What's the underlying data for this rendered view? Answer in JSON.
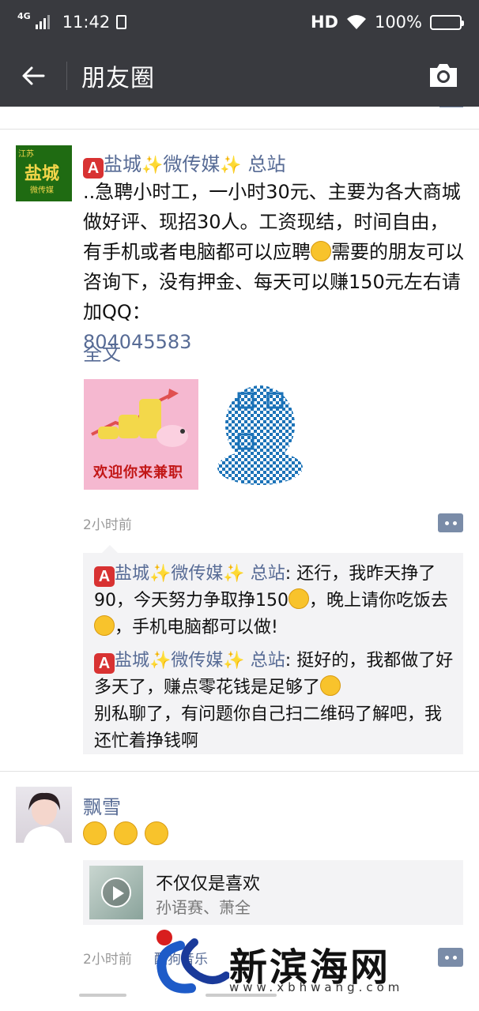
{
  "status_bar": {
    "network": "4G",
    "time": "11:42",
    "hd": "HD",
    "battery": "100%"
  },
  "header": {
    "title": "朋友圈"
  },
  "posts": [
    {
      "avatar": {
        "line1": "江苏",
        "line2": "盐城",
        "line3": "微传媒"
      },
      "badge": "A",
      "name_p1": "盐城",
      "spark": "✨",
      "name_p2": "微传媒",
      "name_p3": " 总站",
      "text": "..急聘小时工，一小时30元、主要为各大商城做好评、现招30人。工资现结，时间自由，有手机或者电脑都可以应聘",
      "text2": "需要的朋友可以咨询下，没有押金、每天可以赚150元左右请加QQ：",
      "qq": "804045583",
      "full_text": "全文",
      "image1_caption": "欢迎你来兼职",
      "time": "2小时前",
      "comments": [
        {
          "name": "盐城✨微传媒✨ 总站",
          "text1": "还行，我昨天挣了90，今天努力争取挣150",
          "text2": "，晚上请你吃饭去",
          "text3": "，手机电脑都可以做!"
        },
        {
          "name": "盐城✨微传媒✨ 总站",
          "text1": "挺好的，我都做了好多天了，赚点零花钱是足够了",
          "text2": "别私聊了，有问题你自己扫二维码了解吧，我还忙着挣钱啊"
        }
      ]
    },
    {
      "name": "飘雪",
      "share_title": "不仅仅是喜欢",
      "share_artist": "孙语赛、萧全",
      "time": "2小时前",
      "source": "酷狗音乐"
    }
  ],
  "watermark": {
    "name": "新滨海网",
    "url": "www.xbhwang.com"
  }
}
